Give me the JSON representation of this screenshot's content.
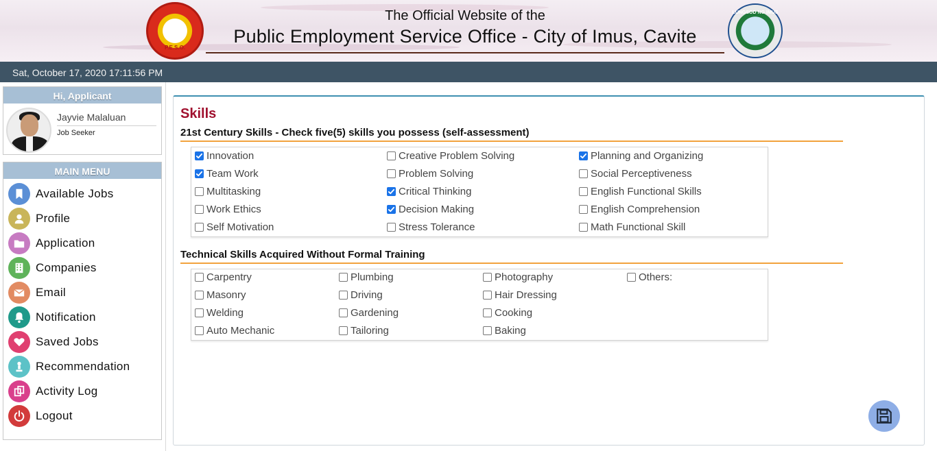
{
  "header": {
    "title_line1": "The Official Website of the",
    "title_line2": "Public Employment Service Office - City of Imus, Cavite",
    "logo_left_text": "P.E.S.O.",
    "logo_right_text": "LUNGSOD NG IMUS"
  },
  "datebar": {
    "datetime": "Sat, October 17, 2020 17:11:56 PM"
  },
  "user_panel": {
    "heading": "Hi, Applicant",
    "name": "Jayvie Malaluan",
    "role": "Job Seeker"
  },
  "menu": {
    "heading": "MAIN MENU",
    "items": [
      {
        "label": "Available Jobs",
        "icon": "bookmark-icon",
        "color": "#5b8fd6"
      },
      {
        "label": "Profile",
        "icon": "user-icon",
        "color": "#c9b55a"
      },
      {
        "label": "Application",
        "icon": "folder-icon",
        "color": "#c77bc2"
      },
      {
        "label": "Companies",
        "icon": "building-icon",
        "color": "#5fb35a"
      },
      {
        "label": "Email",
        "icon": "envelope-icon",
        "color": "#e28b62"
      },
      {
        "label": "Notification",
        "icon": "bell-icon",
        "color": "#1f9a8a"
      },
      {
        "label": "Saved Jobs",
        "icon": "heart-icon",
        "color": "#e04070"
      },
      {
        "label": "Recommendation",
        "icon": "trophy-icon",
        "color": "#5cc2c7"
      },
      {
        "label": "Activity Log",
        "icon": "copy-icon",
        "color": "#d9408c"
      },
      {
        "label": "Logout",
        "icon": "power-icon",
        "color": "#d23b3b"
      }
    ]
  },
  "skills": {
    "title": "Skills",
    "century_heading": "21st Century Skills - Check five(5) skills you possess (self-assessment)",
    "century_items": [
      {
        "label": "Innovation",
        "checked": true
      },
      {
        "label": "Team Work",
        "checked": true
      },
      {
        "label": "Multitasking",
        "checked": false
      },
      {
        "label": "Work Ethics",
        "checked": false
      },
      {
        "label": "Self Motivation",
        "checked": false
      },
      {
        "label": "Creative Problem Solving",
        "checked": false
      },
      {
        "label": "Problem Solving",
        "checked": false
      },
      {
        "label": "Critical Thinking",
        "checked": true
      },
      {
        "label": "Decision Making",
        "checked": true
      },
      {
        "label": "Stress Tolerance",
        "checked": false
      },
      {
        "label": "Planning and Organizing",
        "checked": true
      },
      {
        "label": "Social Perceptiveness",
        "checked": false
      },
      {
        "label": "English Functional Skills",
        "checked": false
      },
      {
        "label": "English Comprehension",
        "checked": false
      },
      {
        "label": "Math Functional Skill",
        "checked": false
      }
    ],
    "technical_heading": "Technical Skills Acquired Without Formal Training",
    "technical_items": [
      {
        "label": "Carpentry",
        "checked": false
      },
      {
        "label": "Masonry",
        "checked": false
      },
      {
        "label": "Welding",
        "checked": false
      },
      {
        "label": "Auto Mechanic",
        "checked": false
      },
      {
        "label": "Plumbing",
        "checked": false
      },
      {
        "label": "Driving",
        "checked": false
      },
      {
        "label": "Gardening",
        "checked": false
      },
      {
        "label": "Tailoring",
        "checked": false
      },
      {
        "label": "Photography",
        "checked": false
      },
      {
        "label": "Hair Dressing",
        "checked": false
      },
      {
        "label": "Cooking",
        "checked": false
      },
      {
        "label": "Baking",
        "checked": false
      },
      {
        "label": "Others:",
        "checked": false
      }
    ],
    "save_icon": "floppy-disk-icon"
  }
}
